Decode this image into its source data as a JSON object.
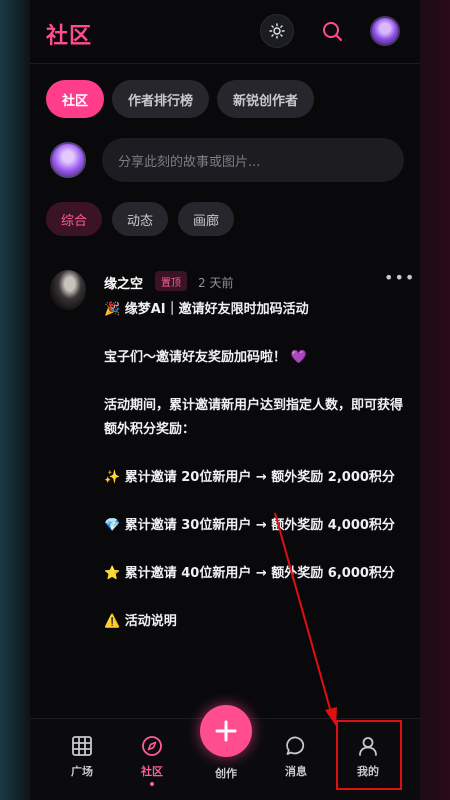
{
  "header": {
    "title": "社区",
    "icons": [
      "sun-icon",
      "search-icon"
    ]
  },
  "tabs": [
    {
      "label": "社区",
      "active": true
    },
    {
      "label": "作者排行榜",
      "active": false
    },
    {
      "label": "新锐创作者",
      "active": false
    }
  ],
  "composer": {
    "placeholder": "分享此刻的故事或图片..."
  },
  "subtabs": [
    {
      "label": "综合",
      "active": true
    },
    {
      "label": "动态",
      "active": false
    },
    {
      "label": "画廊",
      "active": false
    }
  ],
  "post": {
    "author": "缘之空",
    "badge": "置顶",
    "time": "2 天前",
    "headline": "🎉 缘梦AI｜邀请好友限时加码活动",
    "line1": "宝子们～邀请好友奖励加码啦！ 💜",
    "line2": "活动期间，累计邀请新用户达到指定人数，即可获得额外积分奖励：",
    "reward1": "✨ 累计邀请 20位新用户 → 额外奖励 2,000积分",
    "reward2": "💎 累计邀请 30位新用户 → 额外奖励 4,000积分",
    "reward3": "⭐ 累计邀请 40位新用户 → 额外奖励 6,000积分",
    "notice": "⚠️ 活动说明"
  },
  "nav": {
    "plaza": "广场",
    "community": "社区",
    "create": "创作",
    "messages": "消息",
    "mine": "我的"
  },
  "colors": {
    "accent": "#ff4d8f",
    "annotation": "#e01010"
  }
}
